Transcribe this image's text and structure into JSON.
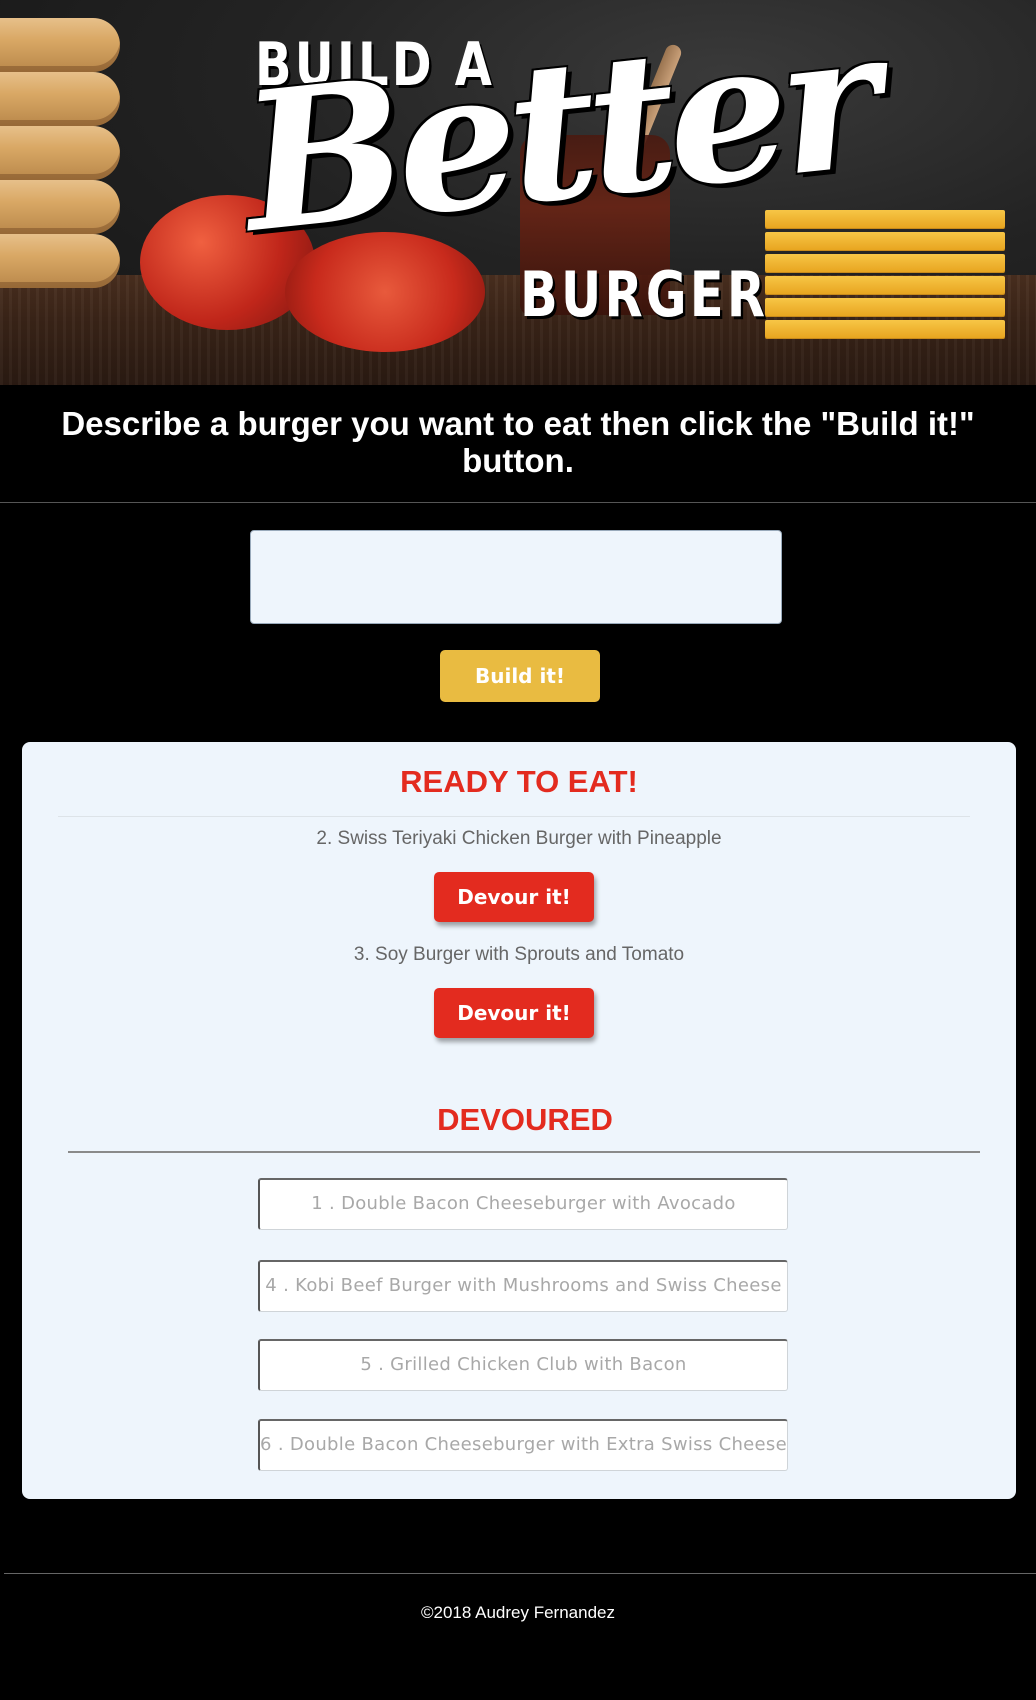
{
  "header": {
    "logo_line1": "BUILD A",
    "logo_line2": "Better",
    "logo_line3": "BURGER"
  },
  "instruction": "Describe a burger you want to eat then click the \"Build it!\" button.",
  "form": {
    "input_value": "",
    "build_label": "Build it!"
  },
  "ready": {
    "title": "READY TO EAT!",
    "items": [
      {
        "text": "2. Swiss Teriyaki Chicken Burger with Pineapple",
        "button": "Devour it!"
      },
      {
        "text": "3. Soy Burger with Sprouts and Tomato",
        "button": "Devour it!"
      }
    ]
  },
  "devoured": {
    "title": "DEVOURED",
    "items": [
      "1 . Double Bacon Cheeseburger with Avocado",
      "4 . Kobi Beef Burger with Mushrooms and Swiss Cheese",
      "5 . Grilled Chicken Club with Bacon",
      "6 . Double Bacon Cheeseburger with Extra Swiss Cheese"
    ]
  },
  "footer": {
    "copyright": "©2018 Audrey Fernandez"
  },
  "colors": {
    "accent_red": "#e32b1f",
    "button_yellow": "#e9bb41",
    "panel_bg": "#eef5fc"
  }
}
